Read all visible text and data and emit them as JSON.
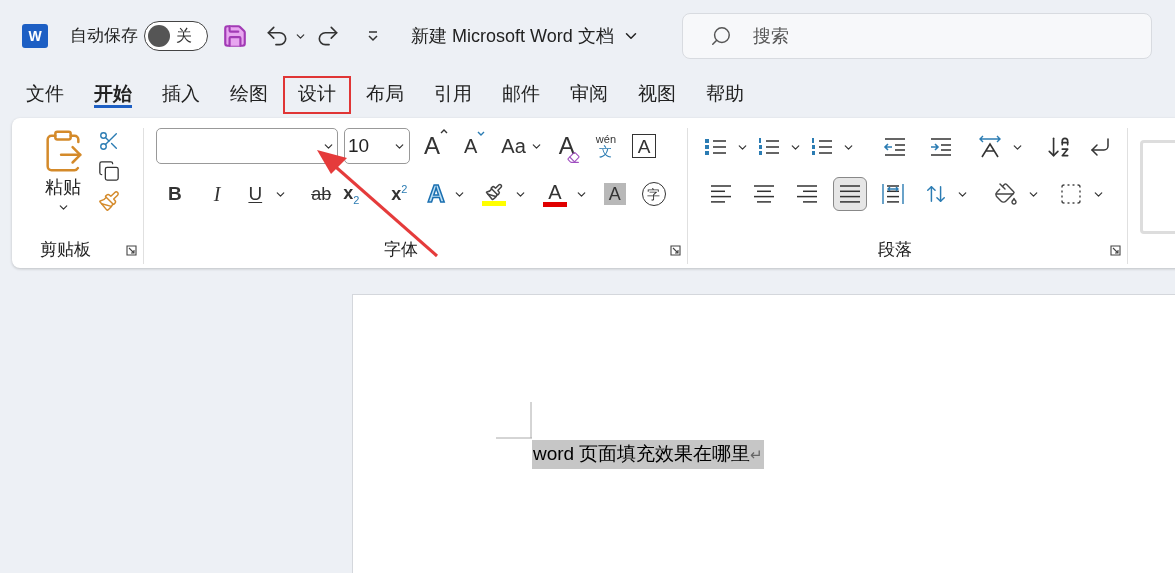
{
  "title_bar": {
    "logo": "W",
    "autosave": {
      "label": "自动保存",
      "on": false,
      "state_text": "关"
    },
    "document_title": "新建 Microsoft Word 文档"
  },
  "search": {
    "placeholder": "搜索"
  },
  "tabs": [
    {
      "label": "文件",
      "selected": false,
      "annotated": false
    },
    {
      "label": "开始",
      "selected": true,
      "annotated": false
    },
    {
      "label": "插入",
      "selected": false,
      "annotated": false
    },
    {
      "label": "绘图",
      "selected": false,
      "annotated": false
    },
    {
      "label": "设计",
      "selected": false,
      "annotated": true
    },
    {
      "label": "布局",
      "selected": false,
      "annotated": false
    },
    {
      "label": "引用",
      "selected": false,
      "annotated": false
    },
    {
      "label": "邮件",
      "selected": false,
      "annotated": false
    },
    {
      "label": "审阅",
      "selected": false,
      "annotated": false
    },
    {
      "label": "视图",
      "selected": false,
      "annotated": false
    },
    {
      "label": "帮助",
      "selected": false,
      "annotated": false
    }
  ],
  "ribbon": {
    "clipboard": {
      "title": "剪贴板",
      "paste_label": "粘贴"
    },
    "font": {
      "title": "字体",
      "font_size": "10",
      "row_1": [
        {
          "kind": "grow",
          "glyph": "A"
        },
        {
          "kind": "shrink",
          "glyph": "A"
        },
        {
          "kind": "case",
          "glyph": "Aa"
        },
        {
          "kind": "clear",
          "glyph": "A"
        },
        {
          "kind": "phonetic",
          "glyph": "文",
          "mark": "wén"
        },
        {
          "kind": "border",
          "glyph": "A"
        }
      ],
      "row_2": [
        {
          "kind": "bold",
          "glyph": "B"
        },
        {
          "kind": "italic",
          "glyph": "I"
        },
        {
          "kind": "underline",
          "glyph": "U"
        },
        {
          "kind": "strike",
          "glyph": "ab"
        },
        {
          "kind": "sub",
          "glyph": "x",
          "mark": "2"
        },
        {
          "kind": "sup",
          "glyph": "x",
          "mark": "2"
        },
        {
          "kind": "effects",
          "glyph": "A"
        },
        {
          "kind": "highlight",
          "color": "#ffff00"
        },
        {
          "kind": "color",
          "glyph": "A",
          "color": "#e00000"
        },
        {
          "kind": "shade",
          "glyph": "A"
        },
        {
          "kind": "enclose",
          "glyph": "字"
        }
      ]
    },
    "paragraph": {
      "title": "段落",
      "align": [
        {
          "kind": "left",
          "selected": false
        },
        {
          "kind": "center",
          "selected": false
        },
        {
          "kind": "right",
          "selected": false
        },
        {
          "kind": "justify",
          "selected": true
        },
        {
          "kind": "distributed",
          "selected": false
        }
      ]
    }
  },
  "document": {
    "text": "word 页面填充效果在哪里",
    "paragraph_mark": "↵",
    "selected": true
  }
}
